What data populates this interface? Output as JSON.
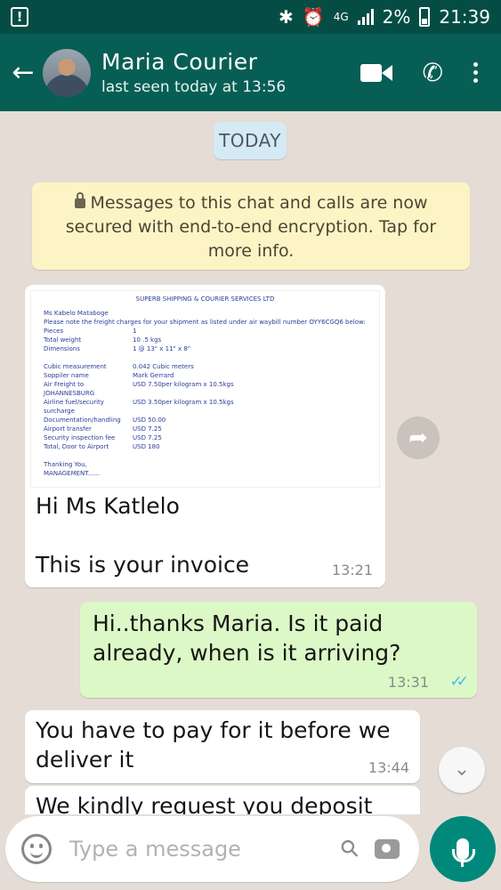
{
  "status_bar": {
    "network": "4G",
    "battery": "2%",
    "time": "21:39"
  },
  "header": {
    "contact_name": "Maria Courier",
    "last_seen": "last seen today at 13:56"
  },
  "chat": {
    "date_label": "TODAY",
    "encryption_notice": "Messages to this chat and calls are now secured with end-to-end encryption. Tap for more info.",
    "messages": [
      {
        "direction": "in",
        "invoice": {
          "title": "SUPERB SHIPPING & COURIER SERVICES LTD",
          "greeting": "Ms Kabelo Mataboge",
          "intro": "Please note the freight charges for your shipment as listed under air waybill number OYY6CGQ6 below:",
          "rows": [
            {
              "label": "Pieces",
              "value": "1"
            },
            {
              "label": "Total weight",
              "value": "10 .5 kgs"
            },
            {
              "label": "Dimensions",
              "value": "1 @ 13\" x 11\" x 8\""
            },
            {
              "label": "Cubic measurement",
              "value": "0.042 Cubic meters"
            },
            {
              "label": "Soppiler name",
              "value": "Mark Gerrard"
            },
            {
              "label": "Air Freight to JOHANNESBURG",
              "value": "USD 7.50per kilogram x 10.5kgs"
            },
            {
              "label": "Airline fuel/security surcharge",
              "value": "USD 3.50per kilogram x 10.5kgs"
            },
            {
              "label": "Documentation/handling",
              "value": "USD 50.00"
            },
            {
              "label": "Airport transfer",
              "value": "USD 7.25"
            },
            {
              "label": "Security inspection fee",
              "value": "USD 7.25"
            },
            {
              "label": "Total, Door to Airport",
              "value": "USD 180"
            }
          ],
          "sign_1": "Thanking You,",
          "sign_2": "MANAGEMENT......"
        },
        "line1": "Hi Ms Katlelo",
        "line2": "This is your invoice",
        "time": "13:21"
      },
      {
        "direction": "out",
        "text": "Hi..thanks Maria.  Is it paid already, when is it arriving?",
        "time": "13:31",
        "ticks": "✓✓"
      },
      {
        "direction": "in",
        "text": "You have to pay for it before we deliver it",
        "time": "13:44"
      },
      {
        "direction": "in",
        "text": "We kindly request you deposit the"
      }
    ]
  },
  "composer": {
    "placeholder": "Type a message"
  },
  "colors": {
    "header": "#075e54",
    "status_bar": "#054d44",
    "outgoing_bubble": "#dcf8c6",
    "accent": "#00897b",
    "read_ticks": "#4fb6ec"
  },
  "icons": [
    "back-arrow-icon",
    "video-call-icon",
    "phone-icon",
    "more-options-icon",
    "lock-icon",
    "share-icon",
    "scroll-down-icon",
    "emoji-icon",
    "attach-icon",
    "camera-icon",
    "mic-icon"
  ]
}
